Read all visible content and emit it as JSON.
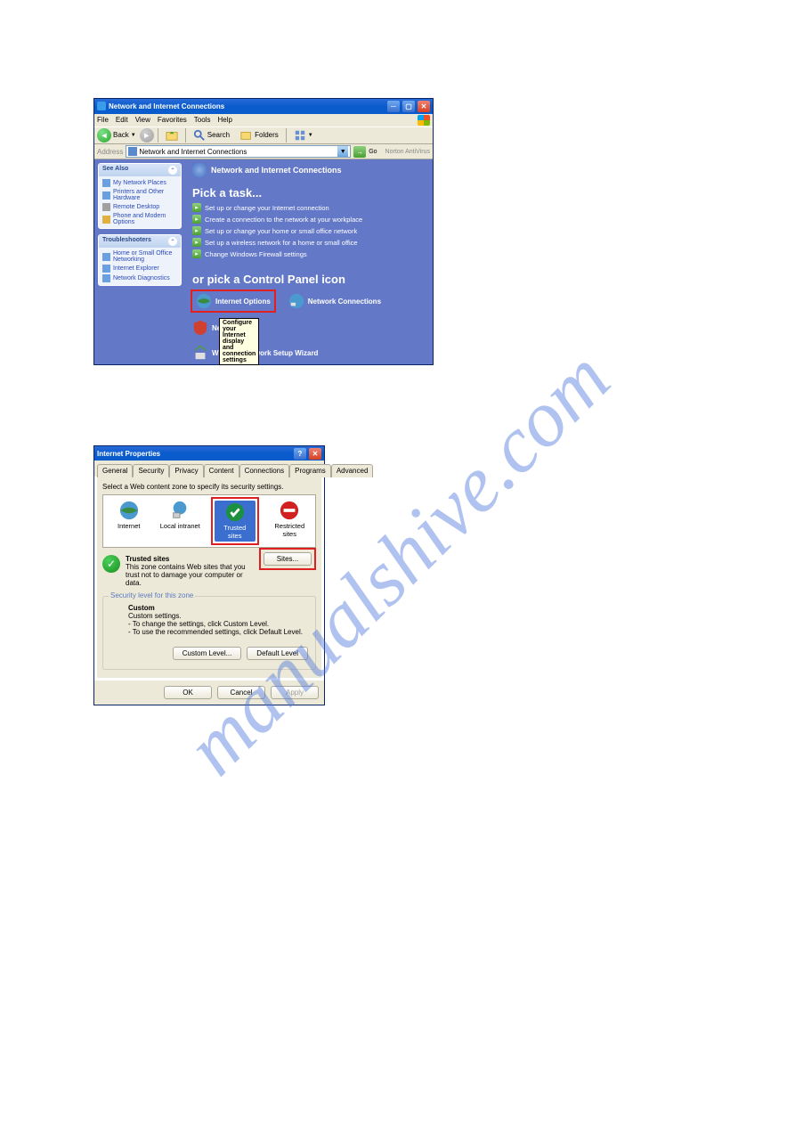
{
  "watermark": "manualshive.com",
  "win1": {
    "title": "Network and Internet Connections",
    "menu": [
      "File",
      "Edit",
      "View",
      "Favorites",
      "Tools",
      "Help"
    ],
    "toolbar": {
      "back": "Back",
      "search": "Search",
      "folders": "Folders"
    },
    "address_label": "Address",
    "address_value": "Network and Internet Connections",
    "go_label": "Go",
    "norton": "Norton AntiVirus",
    "panels": {
      "see_also": {
        "title": "See Also",
        "items": [
          "My Network Places",
          "Printers and Other Hardware",
          "Remote Desktop",
          "Phone and Modem Options"
        ]
      },
      "troubleshooters": {
        "title": "Troubleshooters",
        "items": [
          "Home or Small Office Networking",
          "Internet Explorer",
          "Network Diagnostics"
        ]
      }
    },
    "main_header": "Network and Internet Connections",
    "pick_task": "Pick a task...",
    "tasks": [
      "Set up or change your Internet connection",
      "Create a connection to the network at your workplace",
      "Set up or change your home or small office network",
      "Set up a wireless network for a home or small office",
      "Change Windows Firewall settings"
    ],
    "or_pick": "or pick a Control Panel icon",
    "cp_icons": {
      "internet_options": "Internet Options",
      "network_connections": "Network Connections",
      "nets": "Nets",
      "wireless": "Wireless Network Setup Wizard"
    },
    "tooltip": "Configure your Internet display and connection settings"
  },
  "win2": {
    "title": "Internet Properties",
    "tabs": [
      "General",
      "Security",
      "Privacy",
      "Content",
      "Connections",
      "Programs",
      "Advanced"
    ],
    "active_tab": "Security",
    "instruction": "Select a Web content zone to specify its security settings.",
    "zones": {
      "internet": "Internet",
      "local": "Local intranet",
      "trusted": "Trusted sites",
      "restricted": "Restricted sites"
    },
    "trusted_title": "Trusted sites",
    "trusted_desc": "This zone contains Web sites that you trust not to damage your computer or data.",
    "sites_btn": "Sites...",
    "sec_level_legend": "Security level for this zone",
    "custom_title": "Custom",
    "custom_line1": "Custom settings.",
    "custom_line2": "- To change the settings, click Custom Level.",
    "custom_line3": "- To use the recommended settings, click Default Level.",
    "custom_level_btn": "Custom Level...",
    "default_level_btn": "Default Level",
    "ok": "OK",
    "cancel": "Cancel",
    "apply": "Apply"
  }
}
